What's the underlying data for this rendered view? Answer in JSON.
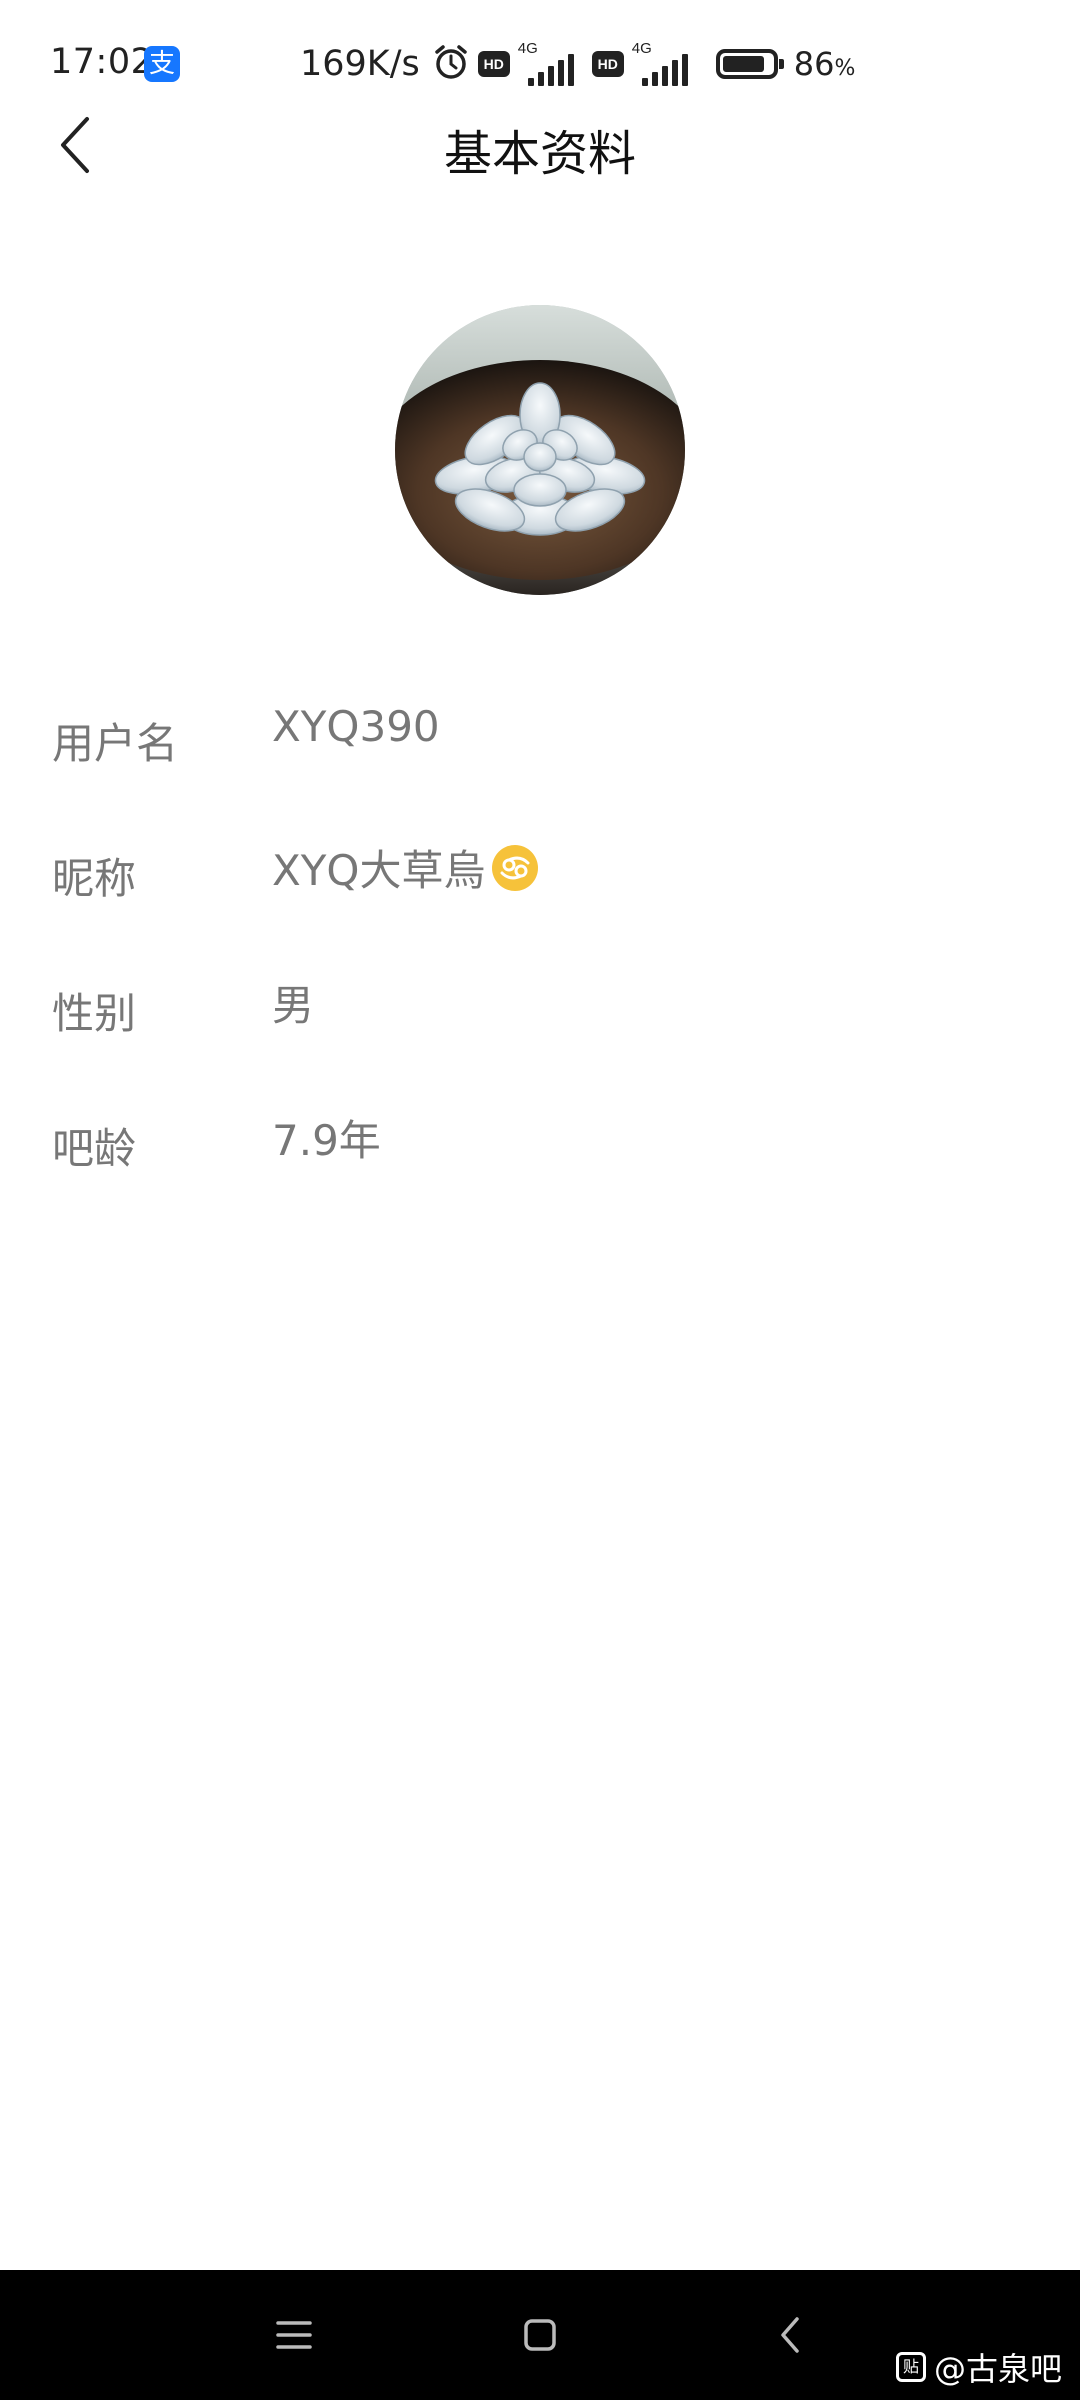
{
  "status_bar": {
    "time": "17:02",
    "alipay_glyph": "支",
    "net_speed": "169K/s",
    "alarm_icon": "alarm-clock-icon",
    "sim1": {
      "hd_label": "HD",
      "network": "4G"
    },
    "sim2": {
      "hd_label": "HD",
      "network": "4G"
    },
    "battery_level": 0.86,
    "battery_pct": "86",
    "battery_unit": "%"
  },
  "header": {
    "back_icon": "chevron-left-icon",
    "title": "基本资料"
  },
  "avatar": {
    "icon": "succulent-photo"
  },
  "profile": {
    "rows": [
      {
        "label": "用户名",
        "value": "XYQ390"
      },
      {
        "label": "昵称",
        "value": "XYQ大草烏",
        "badge_icon": "cancer-zodiac-icon"
      },
      {
        "label": "性别",
        "value": "男"
      },
      {
        "label": "吧龄",
        "value": "7.9年"
      }
    ]
  },
  "nav_bar": {
    "menu_icon": "menu-icon",
    "home_icon": "home-square-icon",
    "back_icon": "back-chevron-icon"
  },
  "watermark": {
    "logo_glyph": "贴",
    "text": "@古泉吧"
  },
  "colors": {
    "alipay_blue": "#1677ff",
    "label_gray": "#777777",
    "zodiac_yellow": "#f6c23a",
    "navbar_black": "#000000"
  }
}
